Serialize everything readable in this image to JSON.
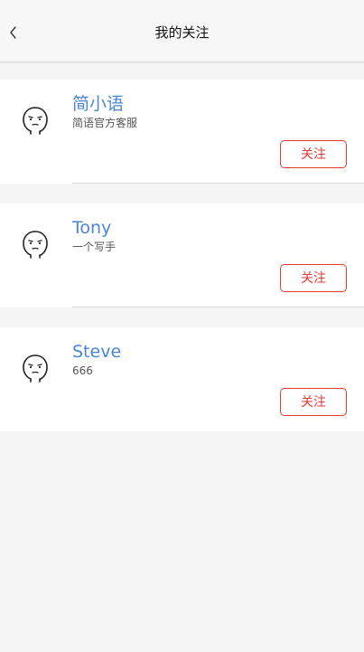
{
  "header": {
    "title": "我的关注",
    "back_icon": "chevron-left-icon"
  },
  "users": [
    {
      "name": "简小语",
      "desc": "简语官方客服",
      "follow_label": "关注",
      "avatar_icon": "doodle-face-icon"
    },
    {
      "name": "Tony",
      "desc": "一个写手",
      "follow_label": "关注",
      "avatar_icon": "doodle-face-icon"
    },
    {
      "name": "Steve",
      "desc": "666",
      "follow_label": "关注",
      "avatar_icon": "doodle-face-icon"
    }
  ],
  "colors": {
    "name": "#4a86d6",
    "follow": "#e53935",
    "background": "#f5f5f5"
  }
}
